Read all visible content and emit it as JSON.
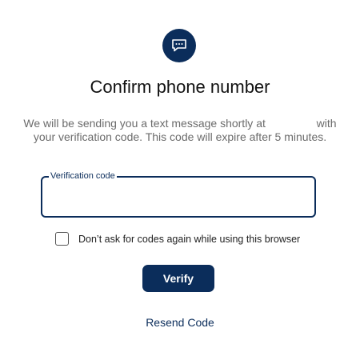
{
  "header": {
    "icon": "chat-bubble-icon",
    "title": "Confirm phone number"
  },
  "description": {
    "part1": "We will be sending you a text message shortly at",
    "part2": "with your verification code. This code will expire after 5 minutes."
  },
  "verification_field": {
    "label": "Verification code",
    "value": ""
  },
  "remember_browser": {
    "label": "Don’t ask for codes again while using this browser",
    "checked": false
  },
  "actions": {
    "verify_label": "Verify",
    "resend_label": "Resend Code"
  },
  "colors": {
    "primary": "#0b2d5b",
    "text_muted": "#6b6b6b",
    "text_dark": "#111111"
  }
}
